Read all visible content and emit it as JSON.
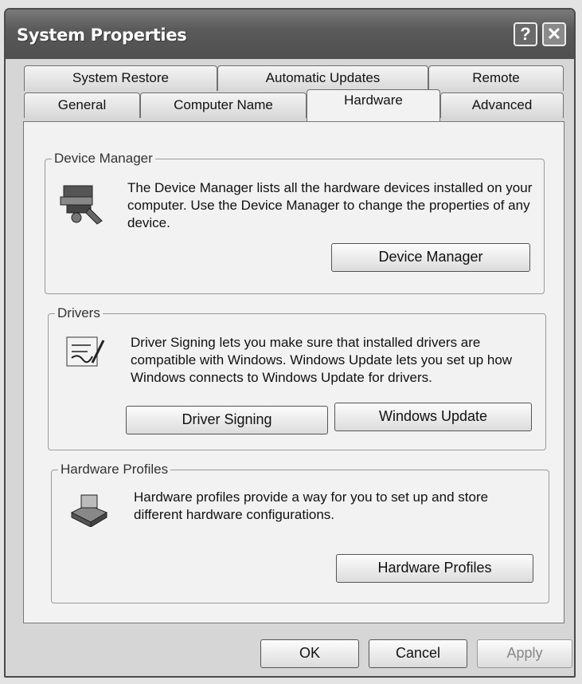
{
  "window": {
    "title": "System Properties"
  },
  "titlebar": {
    "help_label": "?",
    "close_label": "✕"
  },
  "tabs": {
    "back_row": [
      {
        "label": "System Restore"
      },
      {
        "label": "Automatic Updates"
      },
      {
        "label": "Remote"
      }
    ],
    "front_row": [
      {
        "label": "General"
      },
      {
        "label": "Computer Name"
      },
      {
        "label": "Hardware",
        "active": true
      },
      {
        "label": "Advanced"
      }
    ]
  },
  "device_manager": {
    "legend": "Device Manager",
    "description": "The Device Manager lists all the hardware devices installed on your computer. Use the Device Manager to change the properties of any device.",
    "button": "Device Manager",
    "icon": "device-manager-icon"
  },
  "drivers": {
    "legend": "Drivers",
    "description": "Driver Signing lets you make sure that installed drivers are compatible with Windows. Windows Update lets you set up how Windows connects to Windows Update for drivers.",
    "signing_button": "Driver Signing",
    "update_button": "Windows Update",
    "icon": "driver-signing-icon"
  },
  "hardware_profiles": {
    "legend": "Hardware Profiles",
    "description": "Hardware profiles provide a way for you to set up and store different hardware configurations.",
    "button": "Hardware Profiles",
    "icon": "hardware-profiles-icon"
  },
  "footer": {
    "ok": "OK",
    "cancel": "Cancel",
    "apply": "Apply"
  }
}
